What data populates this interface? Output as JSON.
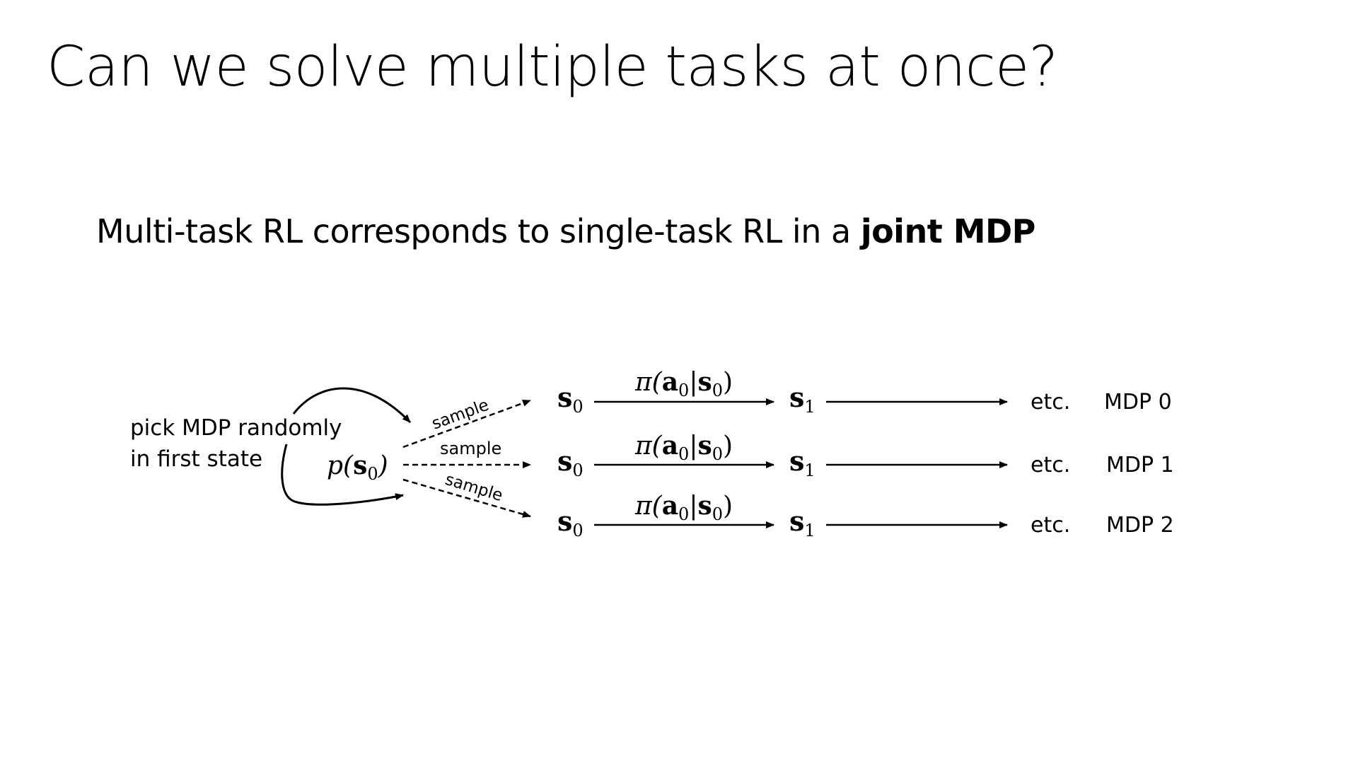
{
  "slide": {
    "title": "Can we solve multiple tasks at once?",
    "subtitle_prefix": "Multi-task RL corresponds to single-task RL in a ",
    "subtitle_bold": "joint MDP"
  },
  "annotation": {
    "line1": "pick MDP randomly",
    "line2": "in first state"
  },
  "initial_state": "p(s0)",
  "edge_labels": {
    "sample_top": "sample",
    "sample_mid": "sample",
    "sample_bot": "sample"
  },
  "rows": [
    {
      "s0": "s0",
      "policy": "π(a0|s0)",
      "s1": "s1",
      "etc": "etc.",
      "mdp": "MDP 0"
    },
    {
      "s0": "s0",
      "policy": "π(a0|s0)",
      "s1": "s1",
      "etc": "etc.",
      "mdp": "MDP 1"
    },
    {
      "s0": "s0",
      "policy": "π(a0|s0)",
      "s1": "s1",
      "etc": "etc.",
      "mdp": "MDP 2"
    }
  ]
}
